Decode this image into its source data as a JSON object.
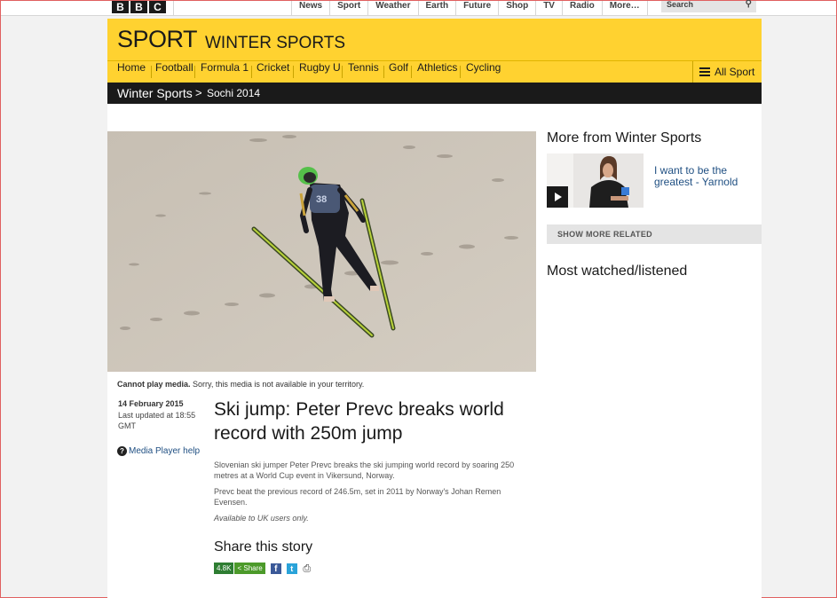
{
  "global_nav": {
    "logo_letters": [
      "B",
      "B",
      "C"
    ],
    "items": [
      "News",
      "Sport",
      "Weather",
      "Earth",
      "Future",
      "Shop",
      "TV",
      "Radio",
      "More…"
    ],
    "search_placeholder": "Search"
  },
  "sport_header": {
    "title": "SPORT",
    "subtitle": "WINTER SPORTS",
    "background": "#ffd230"
  },
  "sport_nav": {
    "items": [
      "Home",
      "Football",
      "Formula 1",
      "Cricket",
      "Rugby U",
      "Tennis",
      "Golf",
      "Athletics",
      "Cycling"
    ],
    "all_sport": "All Sport"
  },
  "breadcrumb": {
    "section": "Winter Sports",
    "separator": ">",
    "subsection": "Sochi 2014"
  },
  "media": {
    "error_bold": "Cannot play media.",
    "error_text": " Sorry, this media is not available in your territory.",
    "bib_number": "38"
  },
  "article": {
    "date": "14 February 2015",
    "updated": "Last updated at 18:55 GMT",
    "media_help": "Media Player help",
    "headline": "Ski jump: Peter Prevc breaks world record with 250m jump",
    "paragraphs": [
      "Slovenian ski jumper Peter Prevc breaks the ski jumping world record by soaring 250 metres at a World Cup event in Vikersund, Norway.",
      "Prevc beat the previous record of 246.5m, set in 2011 by Norway's Johan Remen Evensen.",
      "Available to UK users only."
    ]
  },
  "share": {
    "title": "Share this story",
    "count": "4.8K",
    "share_label": "Share",
    "facebook": "f",
    "twitter": "t",
    "print": "⎙"
  },
  "sidebar": {
    "more_from": "More from Winter Sports",
    "related_link": "I want to be the greatest - Yarnold",
    "show_more": "SHOW MORE RELATED",
    "most_watched": "Most watched/listened"
  }
}
